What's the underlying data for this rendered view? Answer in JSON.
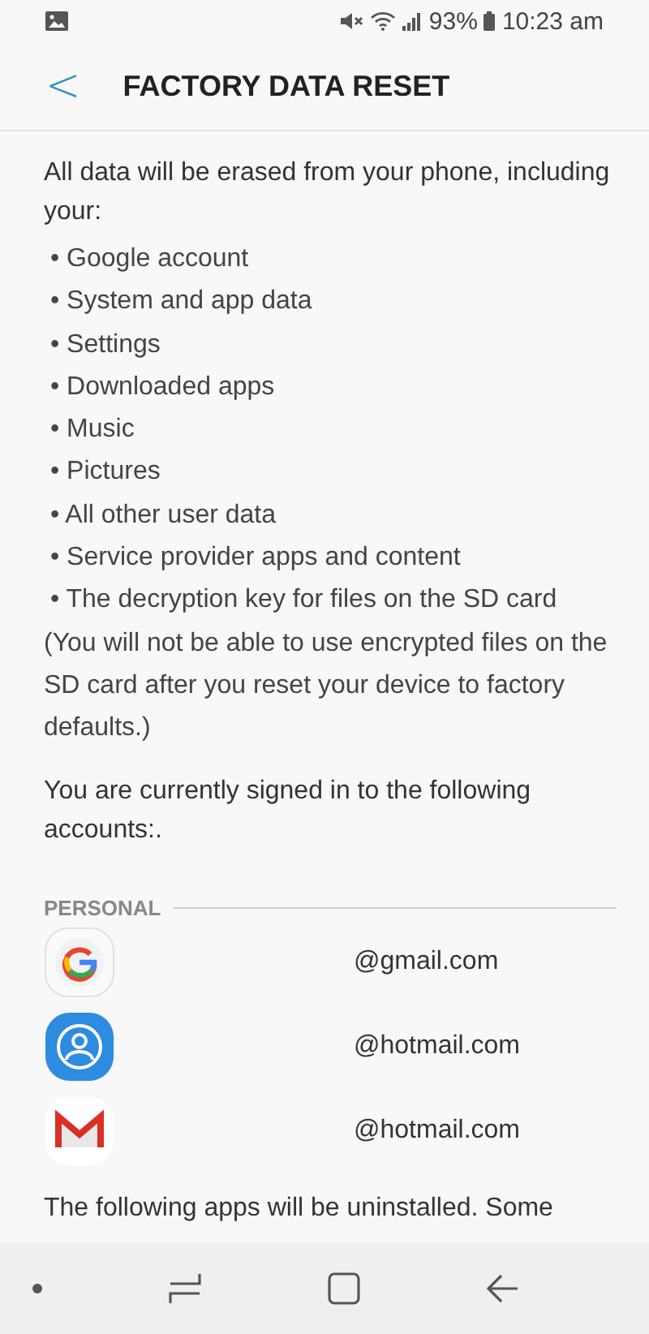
{
  "status_bar": {
    "battery": "93%",
    "time": "10:23 am"
  },
  "header": {
    "back": "<",
    "title": "FACTORY DATA RESET"
  },
  "intro": "All data will be erased from your phone, including your:",
  "bullets": [
    "• Google account",
    "• System and app data",
    "• Settings",
    "• Downloaded apps",
    "• Music",
    "• Pictures",
    "• All other user data",
    "• Service provider apps and content",
    "• The decryption key for files on the SD card"
  ],
  "note": "(You will not be able to use encrypted files on the SD card after you reset your device to factory defaults.)",
  "signed_in": "You are currently signed in to the following accounts:.",
  "section": "PERSONAL",
  "accounts": [
    {
      "kind": "google",
      "email": "@gmail.com"
    },
    {
      "kind": "profile",
      "email": "@hotmail.com"
    },
    {
      "kind": "gmail",
      "email": "@hotmail.com"
    }
  ],
  "footer_text": "The following apps will be uninstalled. Some"
}
